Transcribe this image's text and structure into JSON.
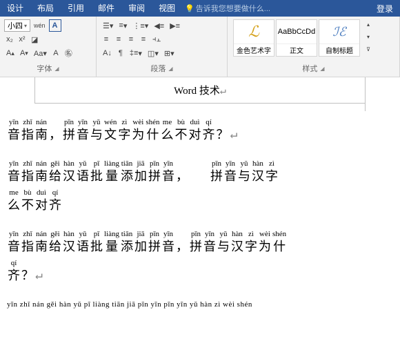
{
  "ribbon": {
    "tabs": [
      "设计",
      "布局",
      "引用",
      "邮件",
      "审阅",
      "视图"
    ],
    "tell_me": "告诉我您想要做什么...",
    "login": "登录"
  },
  "font_group": {
    "size": "小四",
    "pinyin_guide": "wén",
    "char_border": "A",
    "label": "字体"
  },
  "para_group": {
    "label": "段落"
  },
  "styles_group": {
    "label": "样式",
    "items": [
      {
        "name": "金色艺术字"
      },
      {
        "name": "正文",
        "preview": "AaBbCcDd"
      },
      {
        "name": "自制标题"
      }
    ]
  },
  "document": {
    "title": "Word 技术",
    "lines": [
      [
        {
          "py": "yīn",
          "ch": "音"
        },
        {
          "py": "zhǐ",
          "ch": "指"
        },
        {
          "py": "nán",
          "ch": "南"
        },
        {
          "py": "",
          "ch": "，"
        },
        {
          "py": "pīn",
          "ch": "拼"
        },
        {
          "py": "yīn",
          "ch": "音"
        },
        {
          "py": "yǔ",
          "ch": "与"
        },
        {
          "py": "wén",
          "ch": "文"
        },
        {
          "py": "zì",
          "ch": "字"
        },
        {
          "py": "wèi",
          "ch": "为"
        },
        {
          "py": "shén",
          "ch": "什"
        },
        {
          "py": "me",
          "ch": "么"
        },
        {
          "py": "bù",
          "ch": "不"
        },
        {
          "py": "duì",
          "ch": "对"
        },
        {
          "py": "qí",
          "ch": "齐"
        },
        {
          "py": "",
          "ch": "？"
        }
      ],
      [
        {
          "py": "yīn",
          "ch": "音"
        },
        {
          "py": "zhǐ",
          "ch": "指"
        },
        {
          "py": "nán",
          "ch": "南"
        },
        {
          "py": "gěi",
          "ch": "给"
        },
        {
          "py": "hàn",
          "ch": "汉"
        },
        {
          "py": "yǔ",
          "ch": "语"
        },
        {
          "py": "pī",
          "ch": "批"
        },
        {
          "py": "liàng",
          "ch": "量"
        },
        {
          "py": "tiān",
          "ch": "添"
        },
        {
          "py": "jiā",
          "ch": "加"
        },
        {
          "py": "pīn",
          "ch": "拼"
        },
        {
          "py": "yīn",
          "ch": "音"
        },
        {
          "py": "",
          "ch": "，"
        },
        null,
        {
          "py": "pīn",
          "ch": "拼"
        },
        {
          "py": "yīn",
          "ch": "音"
        },
        {
          "py": "yǔ",
          "ch": "与"
        },
        {
          "py": "hàn",
          "ch": "汉"
        },
        {
          "py": "zì",
          "ch": "字"
        }
      ],
      [
        {
          "py": "me",
          "ch": "么"
        },
        {
          "py": "bù",
          "ch": "不"
        },
        {
          "py": "duì",
          "ch": "对"
        },
        {
          "py": "qí",
          "ch": "齐"
        }
      ],
      [
        {
          "py": "yīn",
          "ch": "音"
        },
        {
          "py": "zhǐ",
          "ch": "指"
        },
        {
          "py": "nán",
          "ch": "南"
        },
        {
          "py": "gěi",
          "ch": "给"
        },
        {
          "py": "hàn",
          "ch": "汉"
        },
        {
          "py": "yǔ",
          "ch": "语"
        },
        {
          "py": "pī",
          "ch": "批"
        },
        {
          "py": "liàng",
          "ch": "量"
        },
        {
          "py": "tiān",
          "ch": "添"
        },
        {
          "py": "jiā",
          "ch": "加"
        },
        {
          "py": "pīn",
          "ch": "拼"
        },
        {
          "py": "yīn",
          "ch": "音"
        },
        {
          "py": "",
          "ch": "，"
        },
        {
          "py": "pīn",
          "ch": "拼"
        },
        {
          "py": "yīn",
          "ch": "音"
        },
        {
          "py": "yǔ",
          "ch": "与"
        },
        {
          "py": "hàn",
          "ch": "汉"
        },
        {
          "py": "zì",
          "ch": "字"
        },
        {
          "py": "wèi",
          "ch": "为"
        },
        {
          "py": "shén",
          "ch": "什"
        }
      ],
      [
        {
          "py": "qí",
          "ch": "齐"
        },
        {
          "py": "",
          "ch": "？"
        }
      ]
    ],
    "tail_pinyin": "yīn zhǐ nán gěi hàn yǔ   pī liàng tiān jiā pīn yīn      pīn yīn yǔ hàn zì wèi shén"
  }
}
